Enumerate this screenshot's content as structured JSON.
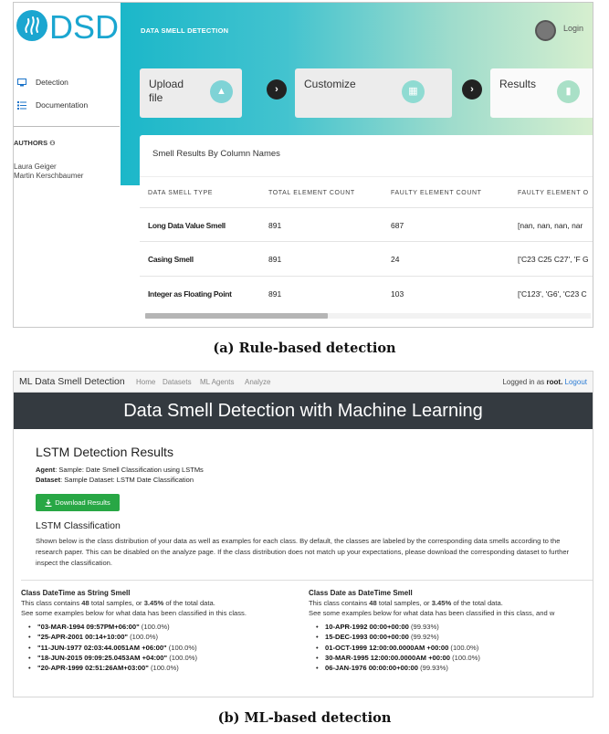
{
  "panel_a": {
    "logo_text": "DSD",
    "sidebar": {
      "items": [
        {
          "label": "Detection",
          "icon": "monitor-icon"
        },
        {
          "label": "Documentation",
          "icon": "list-icon"
        }
      ],
      "authors_title": "AUTHORS",
      "authors": [
        "Laura Geiger",
        "Martin Kerschbaumer"
      ]
    },
    "header": {
      "title": "DATA SMELL DETECTION",
      "login_label": "Login"
    },
    "steps": [
      {
        "label": "Upload file",
        "icon": "cloud-upload-icon"
      },
      {
        "label": "Customize",
        "icon": "grid-icon"
      },
      {
        "label": "Results",
        "icon": "bar-chart-icon"
      }
    ],
    "results_card": {
      "title": "Smell Results By Column Names",
      "columns": [
        "DATA SMELL TYPE",
        "TOTAL ELEMENT COUNT",
        "FAULTY ELEMENT COUNT",
        "FAULTY ELEMENT O"
      ],
      "rows": [
        {
          "type": "Long Data Value Smell",
          "total": "891",
          "faulty": "687",
          "elements": "[nan, nan, nan, nar"
        },
        {
          "type": "Casing Smell",
          "total": "891",
          "faulty": "24",
          "elements": "['C23 C25 C27', 'F G"
        },
        {
          "type": "Integer as Floating Point",
          "total": "891",
          "faulty": "103",
          "elements": "['C123', 'G6', 'C23 C"
        }
      ],
      "horizontal_scroll_fraction": 0.41
    },
    "colors": {
      "banner_start": "#1bb7c9",
      "banner_end": "#d7efcf",
      "logo": "#1ba6d0"
    }
  },
  "caption_a": "(a) Rule-based detection",
  "panel_b": {
    "nav": {
      "brand": "ML Data Smell Detection",
      "links": [
        "Home",
        "Datasets",
        "ML Agents",
        "Analyze"
      ],
      "logged_prefix": "Logged in as",
      "user": "root.",
      "logout": "Logout"
    },
    "header_title": "Data Smell Detection with Machine Learning",
    "results_title": "LSTM Detection Results",
    "agent_label": "Agent",
    "agent_value": ": Sample: Date Smell Classification using LSTMs",
    "dataset_label": "Dataset",
    "dataset_value": ": Sample Dataset: LSTM Date Classification",
    "download_label": "Download Results",
    "classification_title": "LSTM Classification",
    "description": "Shown below is the class distribution of your data as well as examples for each class. By default, the classes are labeled by the corresponding data smells according to the research paper. This can be disabled on the analyze page. If the class distribution does not match up your expectations, please download the corresponding dataset to further inspect the classification.",
    "classes": [
      {
        "title": "Class DateTime as String Smell",
        "count_prefix": "This class contains",
        "count": "48",
        "count_mid": "total samples, or",
        "percent": "3.45%",
        "count_suffix": "of the total data.",
        "examples_text": "See some examples below for what data has been classified in this class.",
        "examples": [
          {
            "value": "\"03-MAR-1994 09:57PM+06:00\"",
            "score": "(100.0%)"
          },
          {
            "value": "\"25-APR-2001 00:14+10:00\"",
            "score": "(100.0%)"
          },
          {
            "value": "\"11-JUN-1977 02:03:44.0051AM +06:00\"",
            "score": "(100.0%)"
          },
          {
            "value": "\"18-JUN-2015 09:09:25.0453AM +04:00\"",
            "score": "(100.0%)"
          },
          {
            "value": "\"20-APR-1999 02:51:26AM+03:00\"",
            "score": "(100.0%)"
          }
        ]
      },
      {
        "title": "Class Date as DateTime Smell",
        "count_prefix": "This class contains",
        "count": "48",
        "count_mid": "total samples, or",
        "percent": "3.45%",
        "count_suffix": "of the total data.",
        "examples_text": "See some examples below for what data has been classified in this class, and w",
        "examples": [
          {
            "value": "10-APR-1992 00:00+00:00",
            "score": "(99.93%)"
          },
          {
            "value": "15-DEC-1993 00:00+00:00",
            "score": "(99.92%)"
          },
          {
            "value": "01-OCT-1999 12:00:00.0000AM +00:00",
            "score": "(100.0%)"
          },
          {
            "value": "30-MAR-1995 12:00:00.0000AM +00:00",
            "score": "(100.0%)"
          },
          {
            "value": "06-JAN-1976 00:00:00+00:00",
            "score": "(99.93%)"
          }
        ]
      }
    ],
    "colors": {
      "header_bg": "#343a40",
      "download_bg": "#28a745",
      "logout": "#2a7bd4"
    }
  },
  "caption_b": "(b) ML-based detection"
}
